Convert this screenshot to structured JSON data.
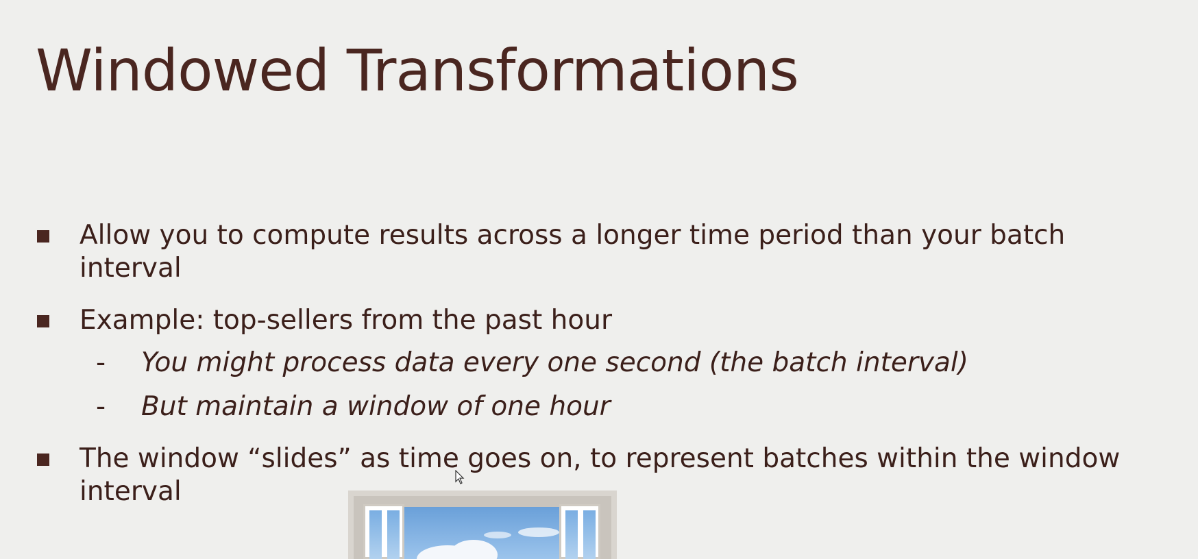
{
  "slide": {
    "title": "Windowed Transformations",
    "bullets": [
      {
        "text": "Allow you to compute results across a longer time period than your batch interval"
      },
      {
        "text": "Example: top-sellers from the past hour",
        "subitems": [
          "You might process data every one second (the batch interval)",
          "But maintain a window of one hour"
        ]
      },
      {
        "text": "The window “slides” as time goes on, to represent batches within the window interval"
      }
    ],
    "sub_marker": "-"
  },
  "colors": {
    "background": "#efefed",
    "title": "#4a2620",
    "text": "#3b1f1a",
    "bullet_marker": "#4a2620"
  },
  "icons": {
    "bullet": "square-bullet-icon",
    "cursor": "mouse-pointer-icon"
  }
}
